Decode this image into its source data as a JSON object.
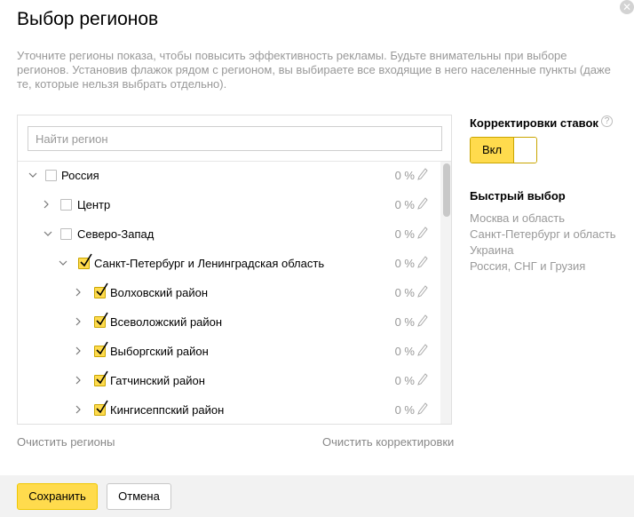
{
  "dialog": {
    "title": "Выбор регионов",
    "description": "Уточните регионы показа, чтобы повысить эффективность рекламы. Будьте внимательны при выборе регионов. Установив флажок рядом с регионом, вы выбираете все входящие в него населенные пункты (даже те, которые нельзя выбрать отдельно).",
    "close_icon": "✕"
  },
  "search": {
    "placeholder": "Найти регион"
  },
  "tree": {
    "rows": [
      {
        "label": "Россия",
        "percent": "0 %",
        "expanded": true,
        "checked": false
      },
      {
        "label": "Центр",
        "percent": "0 %",
        "expanded": false,
        "checked": false
      },
      {
        "label": "Северо-Запад",
        "percent": "0 %",
        "expanded": true,
        "checked": false
      },
      {
        "label": "Санкт-Петербург и Ленинградская область",
        "percent": "0 %",
        "expanded": true,
        "checked": true
      },
      {
        "label": "Волховский район",
        "percent": "0 %",
        "expanded": false,
        "checked": true
      },
      {
        "label": "Всеволожский район",
        "percent": "0 %",
        "expanded": false,
        "checked": true
      },
      {
        "label": "Выборгский район",
        "percent": "0 %",
        "expanded": false,
        "checked": true
      },
      {
        "label": "Гатчинский район",
        "percent": "0 %",
        "expanded": false,
        "checked": true
      },
      {
        "label": "Кингисеппский район",
        "percent": "0 %",
        "expanded": false,
        "checked": true
      }
    ]
  },
  "links": {
    "clear_regions": "Очистить регионы",
    "clear_adjustments": "Очистить корректировки"
  },
  "side": {
    "adjustments_title": "Корректировки ставок",
    "help_icon": "?",
    "toggle_label": "Вкл",
    "quick_title": "Быстрый выбор",
    "quick_items": [
      "Москва и область",
      "Санкт-Петербург и область",
      "Украина",
      "Россия, СНГ и Грузия"
    ]
  },
  "footer": {
    "save_label": "Сохранить",
    "cancel_label": "Отмена"
  },
  "colors": {
    "accent": "#ffdb4d",
    "muted_text": "#999999"
  }
}
